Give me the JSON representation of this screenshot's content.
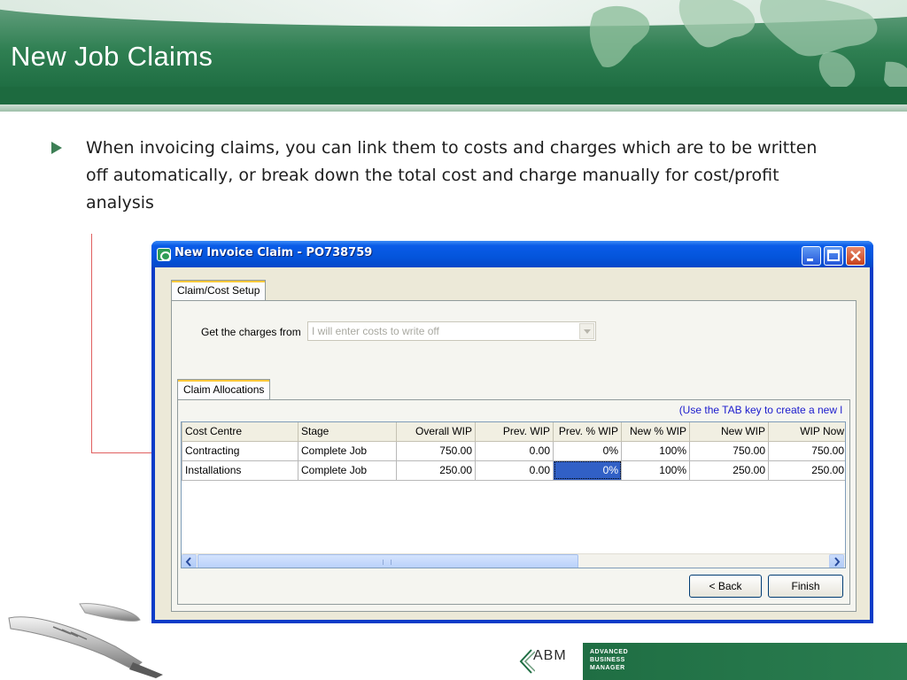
{
  "slide": {
    "title": "New Job Claims",
    "bullet": "When invoicing claims, you can link them to costs and charges which are to be written off automatically, or break down the total cost and charge manually for cost/profit analysis"
  },
  "window": {
    "title": "New Invoice Claim - PO738759",
    "tab_setup": "Claim/Cost Setup",
    "charges_label": "Get the charges from",
    "charges_value": "I will enter costs to write off",
    "tab_allocations": "Claim Allocations",
    "hint": "(Use the TAB key to create a new l",
    "columns": [
      "Cost Centre",
      "Stage",
      "Overall WIP",
      "Prev. WIP",
      "Prev. % WIP",
      "New % WIP",
      "New WIP",
      "WIP Now"
    ],
    "rows": [
      [
        "Contracting",
        "Complete Job",
        "750.00",
        "0.00",
        "0%",
        "100%",
        "750.00",
        "750.00"
      ],
      [
        "Installations",
        "Complete Job",
        "250.00",
        "0.00",
        "0%",
        "100%",
        "250.00",
        "250.00"
      ]
    ],
    "back_button": "< Back",
    "finish_button": "Finish"
  },
  "brand": {
    "logo_mark": "ABM",
    "logo_line1": "ADVANCED",
    "logo_line2": "BUSINESS",
    "logo_line3": "MANAGER",
    "accent": "#1f6e43",
    "titlebar_blue": "#0455dc",
    "selection_blue": "#3160c6"
  }
}
